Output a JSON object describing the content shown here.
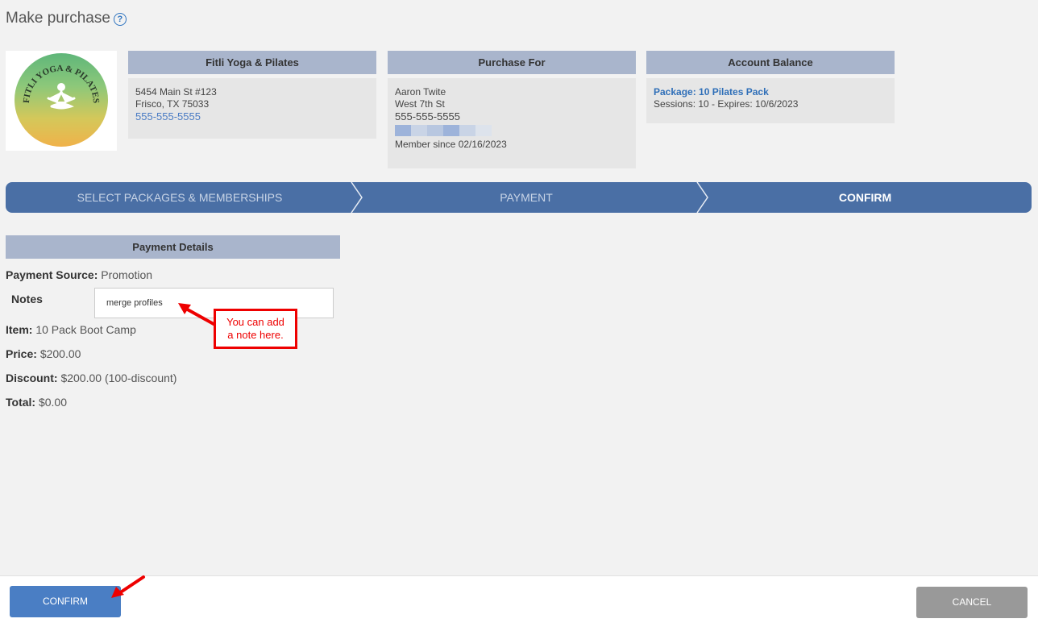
{
  "page": {
    "title": "Make purchase",
    "help_icon": "question-circle-icon"
  },
  "studio": {
    "header": "Fitli Yoga & Pilates",
    "address1": "5454 Main St #123",
    "address2": "Frisco, TX 75033",
    "phone": "555-555-5555",
    "logo_text": "FITLI YOGA & PILATES"
  },
  "purchase_for": {
    "header": "Purchase For",
    "name": "Aaron Twite",
    "street": "West 7th St",
    "phone": "555-555-5555",
    "member_since": "Member since 02/16/2023"
  },
  "balance": {
    "header": "Account Balance",
    "package": "Package: 10 Pilates Pack",
    "sessions": "Sessions: 10 - Expires: 10/6/2023"
  },
  "steps": [
    {
      "label": "SELECT PACKAGES & MEMBERSHIPS",
      "active": false
    },
    {
      "label": "PAYMENT",
      "active": false
    },
    {
      "label": "CONFIRM",
      "active": true
    }
  ],
  "payment": {
    "header": "Payment Details",
    "source_label": "Payment Source:",
    "source_value": "Promotion",
    "notes_label": "Notes",
    "notes_value": "merge profiles",
    "item_label": "Item:",
    "item_value": "10 Pack Boot Camp",
    "price_label": "Price:",
    "price_value": "$200.00",
    "discount_label": "Discount:",
    "discount_value": "$200.00 (100-discount)",
    "total_label": "Total:",
    "total_value": "$0.00"
  },
  "callout": {
    "line1": "You can add",
    "line2": "a note here."
  },
  "footer": {
    "confirm_label": "CONFIRM",
    "cancel_label": "CANCEL"
  },
  "colors": {
    "accent": "#4a6fa5",
    "header_bg": "#a9b5cc",
    "callout": "#e00000"
  }
}
